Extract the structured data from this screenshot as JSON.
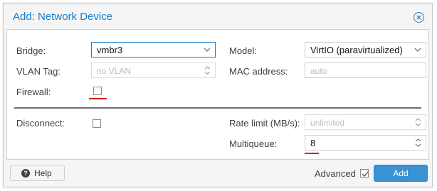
{
  "dialog": {
    "title": "Add: Network Device",
    "close_icon": "close-circle-icon"
  },
  "form": {
    "bridge": {
      "label": "Bridge:",
      "value": "vmbr3"
    },
    "vlan_tag": {
      "label": "VLAN Tag:",
      "placeholder": "no VLAN"
    },
    "firewall": {
      "label": "Firewall:",
      "checked": false
    },
    "model": {
      "label": "Model:",
      "value": "VirtIO (paravirtualized)"
    },
    "mac_address": {
      "label": "MAC address:",
      "placeholder": "auto"
    },
    "disconnect": {
      "label": "Disconnect:",
      "checked": false
    },
    "rate_limit": {
      "label": "Rate limit (MB/s):",
      "placeholder": "unlimited"
    },
    "multiqueue": {
      "label": "Multiqueue:",
      "value": "8"
    }
  },
  "footer": {
    "help_label": "Help",
    "advanced_label": "Advanced",
    "advanced_checked": true,
    "add_label": "Add"
  },
  "colors": {
    "accent": "#157fcc",
    "highlight_underline": "#d81e1e",
    "primary_button": "#3892d4"
  }
}
